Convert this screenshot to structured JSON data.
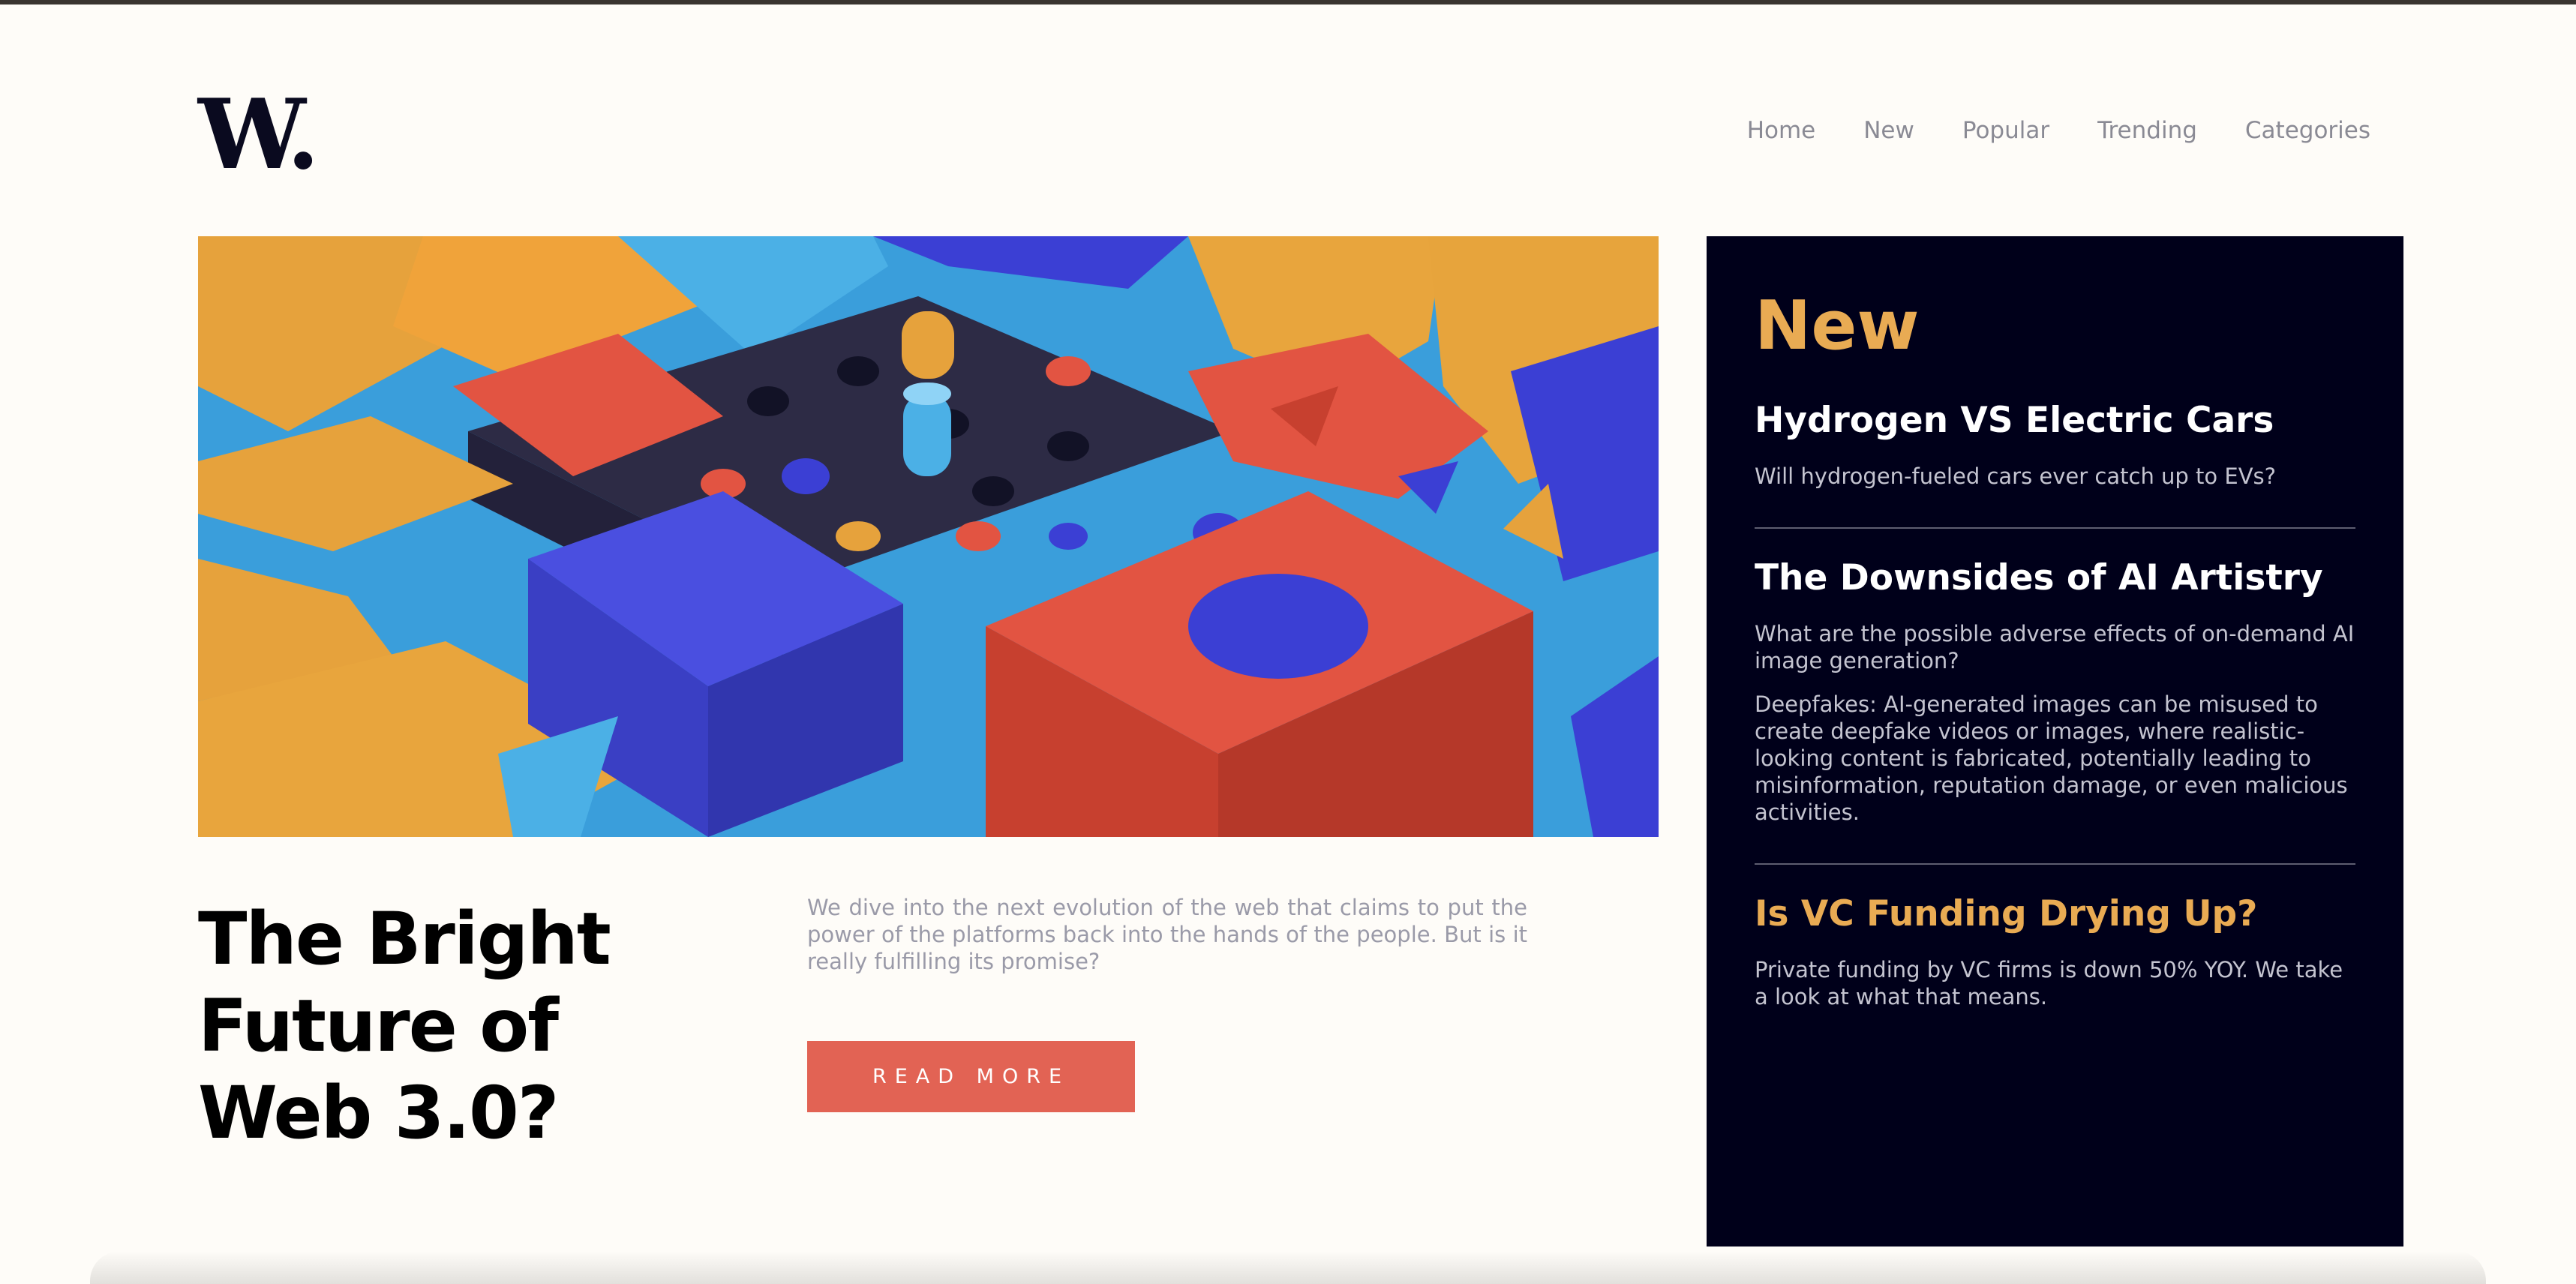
{
  "brand": {
    "logo": "W."
  },
  "nav": {
    "items": [
      "Home",
      "New",
      "Popular",
      "Trending",
      "Categories"
    ]
  },
  "hero": {
    "image_alt": "abstract 3D colored blocks",
    "title_lines": [
      "The Bright",
      "Future of",
      "Web 3.0?"
    ],
    "description": "We dive into the next evolution of the web that claims to put the power of the platforms back into the hands of the people. But is it really fulfilling its promise?",
    "cta_label": "READ MORE"
  },
  "sidebar": {
    "heading": "New",
    "items": [
      {
        "title": "Hydrogen VS Electric Cars",
        "texts": [
          "Will hydrogen-fueled cars ever catch up to EVs?"
        ]
      },
      {
        "title": "The Downsides of AI Artistry",
        "texts": [
          "What are the possible adverse effects of on-demand AI image generation?",
          "Deepfakes: AI-generated images can be misused to create deepfake videos or images, where realistic-looking content is fabricated, potentially leading to misinformation, reputation damage, or even malicious activities."
        ]
      },
      {
        "title": "Is VC Funding Drying Up?",
        "texts": [
          "Private funding by VC firms is down 50% YOY. We take a look at what that means."
        ]
      }
    ]
  },
  "colors": {
    "background": "#fefcf8",
    "accent": "#e9ab53",
    "cta": "#e26354",
    "sidebar_bg": "#00001a"
  }
}
